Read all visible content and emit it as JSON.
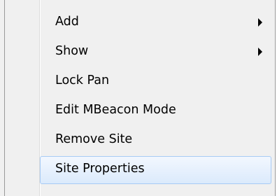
{
  "context_menu": {
    "items": [
      {
        "label": "Add",
        "has_submenu": true,
        "highlighted": false
      },
      {
        "label": "Show",
        "has_submenu": true,
        "highlighted": false
      },
      {
        "label": "Lock Pan",
        "has_submenu": false,
        "highlighted": false
      },
      {
        "label": "Edit MBeacon Mode",
        "has_submenu": false,
        "highlighted": false
      },
      {
        "label": "Remove Site",
        "has_submenu": false,
        "highlighted": false
      },
      {
        "label": "Site Properties",
        "has_submenu": false,
        "highlighted": true
      }
    ]
  },
  "colors": {
    "menu_background": "#f0f0f0",
    "highlight_border": "#a7cbf5",
    "highlight_fill": "#dbeafc",
    "text": "#000000"
  }
}
